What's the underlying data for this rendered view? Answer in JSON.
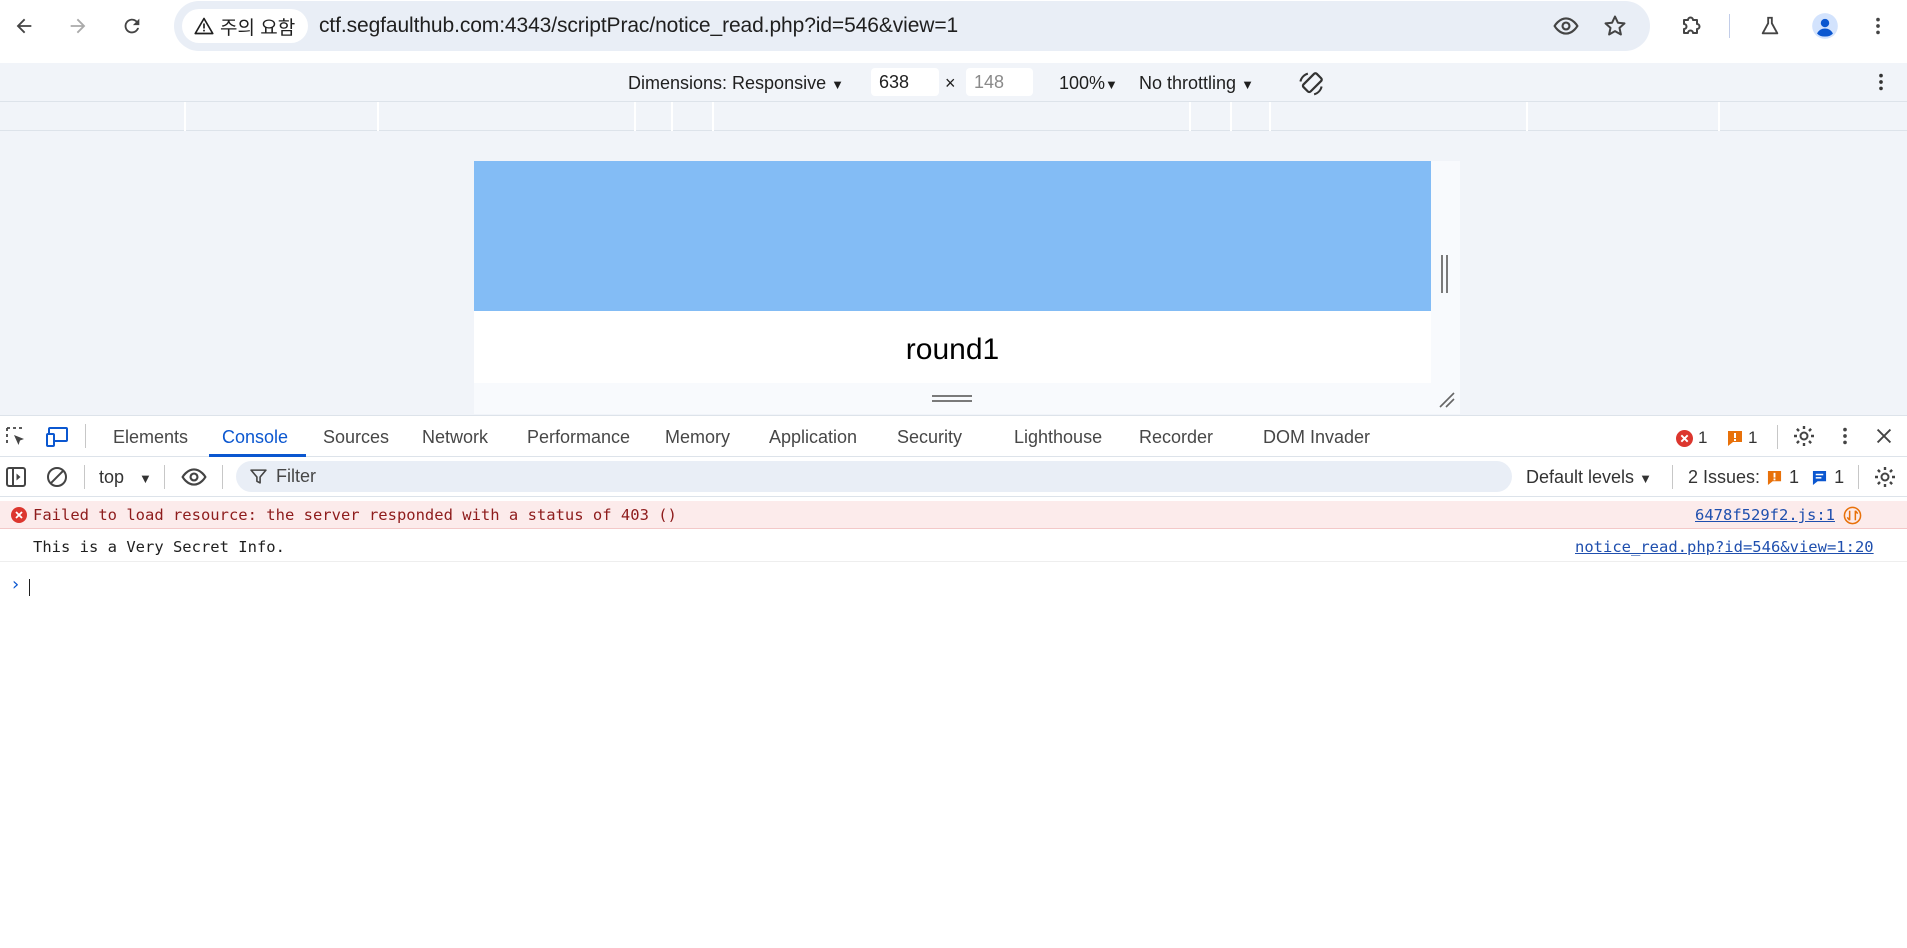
{
  "browser": {
    "security_chip": "주의 요함",
    "url": "ctf.segfaulthub.com:4343/scriptPrac/notice_read.php?id=546&view=1",
    "icons": [
      "back-icon",
      "forward-icon",
      "reload-icon",
      "warning-icon",
      "eye-icon",
      "star-icon",
      "extensions-icon",
      "labs-icon",
      "profile-icon",
      "more-icon"
    ]
  },
  "device_toolbar": {
    "dimensions_label": "Dimensions: Responsive",
    "width": "638",
    "times": "×",
    "height_placeholder": "148",
    "zoom": "100%",
    "throttling": "No throttling"
  },
  "device_page": {
    "title": "round1",
    "hero_color": "#83bcf5"
  },
  "devtools": {
    "tabs": [
      "Elements",
      "Console",
      "Sources",
      "Network",
      "Performance",
      "Memory",
      "Application",
      "Security",
      "Lighthouse",
      "Recorder",
      "DOM Invader"
    ],
    "active_tab": "Console",
    "error_count": "1",
    "warning_count": "1"
  },
  "console_toolbar": {
    "context": "top",
    "filter_placeholder": "Filter",
    "levels": "Default levels",
    "issues_label": "2 Issues:",
    "issues_warning": "1",
    "issues_info": "1"
  },
  "console": {
    "messages": [
      {
        "type": "error",
        "text": "Failed to load resource: the server responded with a status of 403 ()",
        "source": "6478f529f2.js:1"
      },
      {
        "type": "log",
        "text": "This is a Very Secret Info.",
        "source": "notice_read.php?id=546&view=1:20"
      }
    ],
    "prompt": "›"
  },
  "colors": {
    "accent": "#0b57d0",
    "error": "#dc362e",
    "warning": "#e8710a"
  }
}
